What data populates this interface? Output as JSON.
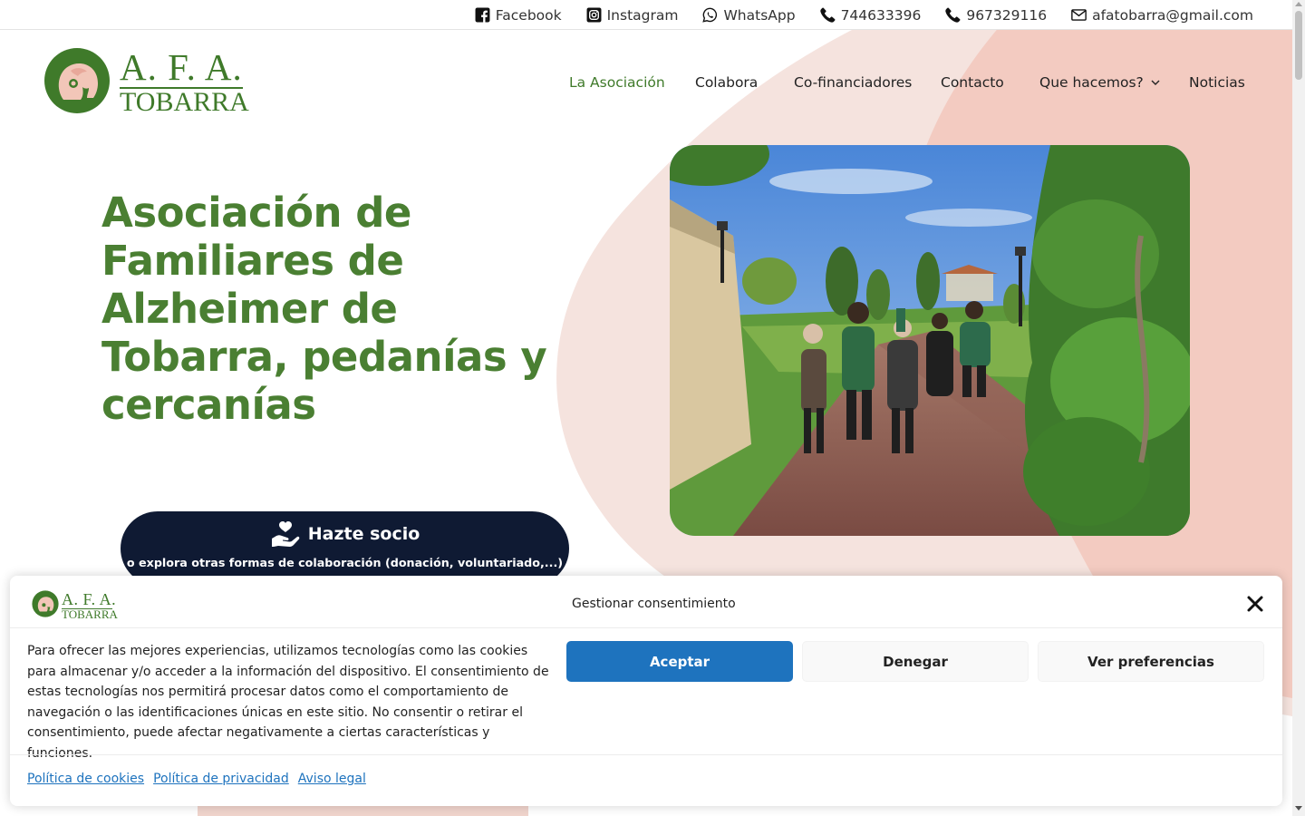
{
  "colors": {
    "brand_green": "#4a7f32",
    "cta_navy": "#0f1a33",
    "accept_blue": "#1e73be",
    "blob_light": "#f5e3de",
    "blob_pink": "#f3cbc1"
  },
  "topbar": {
    "links": [
      {
        "icon": "facebook-icon",
        "label": "Facebook"
      },
      {
        "icon": "instagram-icon",
        "label": "Instagram"
      },
      {
        "icon": "whatsapp-icon",
        "label": "WhatsApp"
      },
      {
        "icon": "phone-icon",
        "label": "744633396"
      },
      {
        "icon": "phone-icon",
        "label": "967329116"
      },
      {
        "icon": "mail-icon",
        "label": "afatobarra@gmail.com"
      }
    ]
  },
  "logo": {
    "title": "A. F. A.",
    "subtitle": "TOBARRA"
  },
  "nav": {
    "items": [
      {
        "label": "La Asociación",
        "active": true
      },
      {
        "label": "Colabora"
      },
      {
        "label": "Co-financiadores"
      },
      {
        "label": "Contacto"
      },
      {
        "label": "Que hacemos?",
        "has_dropdown": true
      },
      {
        "label": "Noticias"
      }
    ]
  },
  "hero": {
    "title": "Asociación de Familiares de Alzheimer de Tobarra, pedanías y cercanías",
    "cta": {
      "icon": "heart-hand-icon",
      "label": "Hazte socio",
      "sublabel": "o explora otras formas de colaboración (donación, voluntariado,...)"
    }
  },
  "consent": {
    "logo_title": "A. F. A.",
    "logo_subtitle": "TOBARRA",
    "title": "Gestionar consentimiento",
    "body": "Para ofrecer las mejores experiencias, utilizamos tecnologías como las cookies para almacenar y/o acceder a la información del dispositivo. El consentimiento de estas tecnologías nos permitirá procesar datos como el comportamiento de navegación o las identificaciones únicas en este sitio. No consentir o retirar el consentimiento, puede afectar negativamente a ciertas características y funciones.",
    "buttons": {
      "accept": "Aceptar",
      "deny": "Denegar",
      "preferences": "Ver preferencias"
    },
    "links": [
      "Política de cookies",
      "Política de privacidad",
      "Aviso legal"
    ]
  }
}
